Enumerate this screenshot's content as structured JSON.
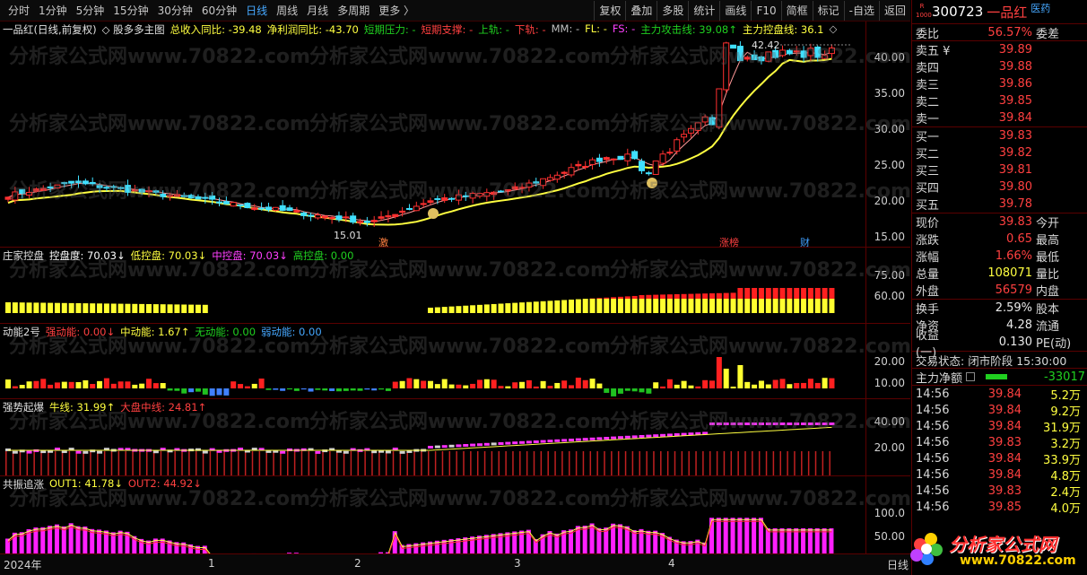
{
  "toolbar": {
    "periods": [
      "分时",
      "1分钟",
      "5分钟",
      "15分钟",
      "30分钟",
      "60分钟",
      "日线",
      "周线",
      "月线",
      "多周期",
      "更多 〉"
    ],
    "active_period": "日线",
    "tools": [
      "复权",
      "叠加",
      "多股",
      "统计",
      "画线",
      "F10",
      "简框",
      "标记",
      "-自选",
      "返回"
    ]
  },
  "main_panel": {
    "legend": [
      {
        "text": "一品红(日线,前复权)",
        "color": "#e0e0e0"
      },
      {
        "text": "◇ 股多多主图",
        "color": "#e0e0e0"
      },
      {
        "text": "总收入同比: -39.48",
        "color": "#ffff40"
      },
      {
        "text": "净利润同比: -43.70",
        "color": "#ffff40"
      },
      {
        "text": "短期压力: -",
        "color": "#20d020"
      },
      {
        "text": "短期支撑: -",
        "color": "#ff4040"
      },
      {
        "text": "上轨: -",
        "color": "#20d020"
      },
      {
        "text": "下轨: -",
        "color": "#ff4040"
      },
      {
        "text": "MM: -",
        "color": "#c0c0c0"
      },
      {
        "text": "FL: -",
        "color": "#ffff40"
      },
      {
        "text": "FS: -",
        "color": "#ff40ff"
      },
      {
        "text": "主力攻击线: 39.08↑",
        "color": "#20d020"
      },
      {
        "text": "主力控盘线: 36.1",
        "color": "#ffff40"
      },
      {
        "text": "◇",
        "color": "#c0c0c0"
      }
    ],
    "y_ticks": [
      "40.00",
      "35.00",
      "30.00",
      "25.00",
      "20.00",
      "15.00"
    ],
    "high_label": "42.42",
    "low_label": "15.01",
    "markers": [
      "激",
      "涨榜",
      "财"
    ],
    "watermark": "分析家公式网www.70822.com"
  },
  "panel2": {
    "legend": [
      {
        "text": "庄家控盘",
        "color": "#e0e0e0"
      },
      {
        "text": "控盘度: 70.03↓",
        "color": "#ffffff"
      },
      {
        "text": "低控盘: 70.03↓",
        "color": "#ffff40"
      },
      {
        "text": "中控盘: 70.03↓",
        "color": "#ff40ff"
      },
      {
        "text": "高控盘: 0.00",
        "color": "#20d020"
      }
    ],
    "y_ticks": [
      "75.00",
      "60.00"
    ]
  },
  "panel3": {
    "legend": [
      {
        "text": "动能2号",
        "color": "#e0e0e0"
      },
      {
        "text": "强动能: 0.00↓",
        "color": "#ff4040"
      },
      {
        "text": "中动能: 1.67↑",
        "color": "#ffff40"
      },
      {
        "text": "无动能: 0.00",
        "color": "#20d020"
      },
      {
        "text": "弱动能: 0.00",
        "color": "#46a8ff"
      }
    ],
    "y_ticks": [
      "20.00",
      "10.00"
    ]
  },
  "panel4": {
    "legend": [
      {
        "text": "强势起爆",
        "color": "#e0e0e0"
      },
      {
        "text": "牛线: 31.99↑",
        "color": "#ffff40"
      },
      {
        "text": "大盘中线: 24.81↑",
        "color": "#ff4040"
      }
    ],
    "y_ticks": [
      "40.00",
      "20.00"
    ]
  },
  "panel5": {
    "legend": [
      {
        "text": "共振追涨",
        "color": "#e0e0e0"
      },
      {
        "text": "OUT1: 41.78↓",
        "color": "#ffff40"
      },
      {
        "text": "OUT2: 44.92↓",
        "color": "#ff4040"
      }
    ],
    "y_ticks": [
      "100.0",
      "50.00"
    ]
  },
  "bottom_axis": {
    "labels": [
      "2024年",
      "1",
      "2",
      "3",
      "4"
    ],
    "right_label": "日线"
  },
  "quote": {
    "r_badge": "R 1000",
    "code": "300723",
    "name": "一品红",
    "sector": "医药",
    "weibi_label": "委比",
    "weibi_value": "56.57%",
    "weicha_label": "委差",
    "sell": [
      {
        "label": "卖五 ¥",
        "price": "39.89"
      },
      {
        "label": "卖四",
        "price": "39.88"
      },
      {
        "label": "卖三",
        "price": "39.86"
      },
      {
        "label": "卖二",
        "price": "39.85"
      },
      {
        "label": "卖一",
        "price": "39.84"
      }
    ],
    "buy": [
      {
        "label": "买一",
        "price": "39.83"
      },
      {
        "label": "买二",
        "price": "39.82"
      },
      {
        "label": "买三",
        "price": "39.81"
      },
      {
        "label": "买四",
        "price": "39.80"
      },
      {
        "label": "买五",
        "price": "39.78"
      }
    ],
    "stats": [
      {
        "l1": "现价",
        "v1": "39.83",
        "c1": "red",
        "l2": "今开"
      },
      {
        "l1": "涨跌",
        "v1": "0.65",
        "c1": "red",
        "l2": "最高"
      },
      {
        "l1": "涨幅",
        "v1": "1.66%",
        "c1": "red",
        "l2": "最低"
      },
      {
        "l1": "总量",
        "v1": "108071",
        "c1": "yellow",
        "l2": "量比"
      },
      {
        "l1": "外盘",
        "v1": "56579",
        "c1": "red",
        "l2": "内盘"
      }
    ],
    "stats2": [
      {
        "l1": "换手",
        "v1": "2.59%",
        "l2": "股本"
      },
      {
        "l1": "净资",
        "v1": "4.28",
        "l2": "流通"
      },
      {
        "l1": "收益(一)",
        "v1": "0.130",
        "l2": "PE(动)"
      }
    ],
    "status_label": "交易状态:",
    "status_value": "闭市阶段 15:30:00",
    "netflow_label": "主力净额",
    "netflow_value": "-33017",
    "trades": [
      {
        "time": "14:56",
        "price": "39.84",
        "vol": "5.2万",
        "color": "yellow"
      },
      {
        "time": "14:56",
        "price": "39.84",
        "vol": "9.2万",
        "color": "yellow"
      },
      {
        "time": "14:56",
        "price": "39.84",
        "vol": "31.9万",
        "color": "yellow"
      },
      {
        "time": "14:56",
        "price": "39.83",
        "vol": "3.2万",
        "color": "yellow"
      },
      {
        "time": "14:56",
        "price": "39.84",
        "vol": "33.9万",
        "color": "yellow"
      },
      {
        "time": "14:56",
        "price": "39.84",
        "vol": "4.8万",
        "color": "yellow"
      },
      {
        "time": "14:56",
        "price": "39.83",
        "vol": "2.4万",
        "color": "yellow"
      },
      {
        "time": "14:56",
        "price": "39.85",
        "vol": "4.0万",
        "color": "yellow"
      }
    ]
  },
  "logo": {
    "text": "分析家公式网",
    "url": "www.70822.com"
  }
}
